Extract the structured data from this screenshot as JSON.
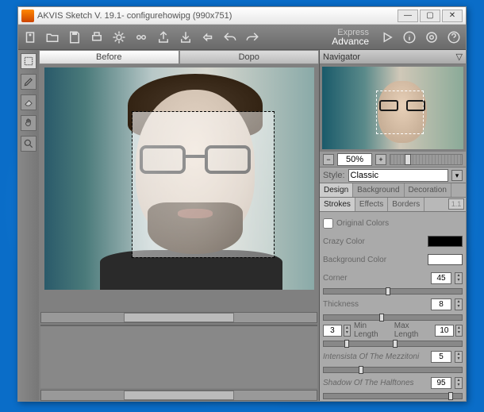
{
  "window": {
    "title": "AKVIS Sketch V. 19.1- configurehowipg (990x751)"
  },
  "modes": {
    "express": "Express",
    "advance": "Advance"
  },
  "tabs": {
    "before": "Before",
    "after": "Dopo"
  },
  "navigator": {
    "title": "Navigator",
    "zoom": "50%"
  },
  "style": {
    "label": "Style:",
    "value": "Classic"
  },
  "panelTabs": {
    "design": "Design",
    "background": "Background",
    "decoration": "Decoration"
  },
  "subTabs": {
    "strokes": "Strokes",
    "effects": "Effects",
    "borders": "Borders",
    "toggle": "1.1"
  },
  "params": {
    "originalColors": "Original Colors",
    "crazyColor": "Crazy Color",
    "backgroundColor": "Background Color",
    "corner": "Corner",
    "cornerVal": "45",
    "thickness": "Thickness",
    "thicknessVal": "8",
    "minLen": "Min Length",
    "minLenVal": "3",
    "maxLen": "Max Length",
    "maxLenVal": "10",
    "intensita": "Intensista Of The Mezzitoni",
    "intensitaVal": "5",
    "shadow": "Shadow Of The Halftones",
    "shadowVal": "95"
  },
  "colors": {
    "crazy": "#000000",
    "bg": "#ffffff"
  }
}
